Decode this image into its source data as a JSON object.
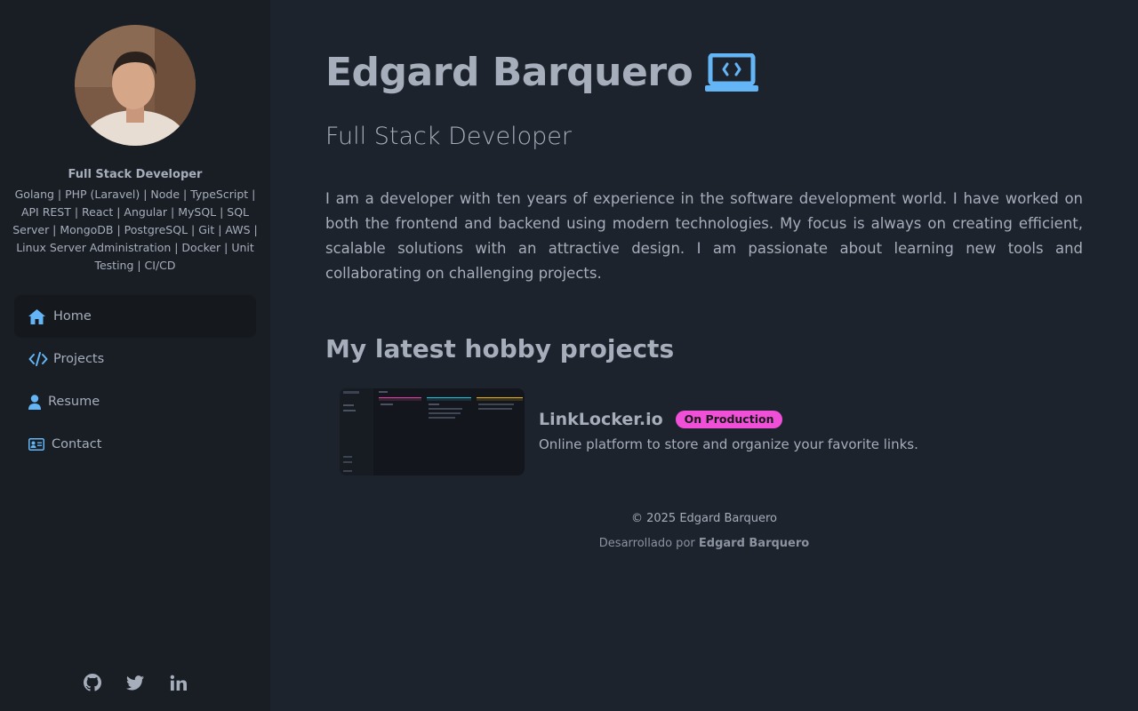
{
  "sidebar": {
    "title": "Full Stack Developer",
    "skills": "Golang | PHP (Laravel) | Node | TypeScript | API REST | React | Angular | MySQL | SQL Server | MongoDB | PostgreSQL | Git | AWS | Linux Server Administration | Docker | Unit Testing | CI/CD",
    "nav": [
      {
        "label": "Home",
        "icon": "home-icon",
        "active": true
      },
      {
        "label": "Projects",
        "icon": "code-icon",
        "active": false
      },
      {
        "label": "Resume",
        "icon": "user-icon",
        "active": false
      },
      {
        "label": "Contact",
        "icon": "contact-card-icon",
        "active": false
      }
    ],
    "social": [
      "github-icon",
      "twitter-icon",
      "linkedin-icon"
    ]
  },
  "main": {
    "name": "Edgard Barquero",
    "name_icon": "laptop-code-icon",
    "role": "Full Stack Developer",
    "bio": "I am a developer with ten years of experience in the software development world. I have worked on both the frontend and backend using modern technologies. My focus is always on creating efficient, scalable solutions with an attractive design. I am passionate about learning new tools and collaborating on challenging projects.",
    "projects_title": "My latest hobby projects",
    "projects": [
      {
        "name": "LinkLocker.io",
        "badge": "On Production",
        "description": "Online platform to store and organize your favorite links."
      }
    ]
  },
  "footer": {
    "copyright": "© 2025 Edgard Barquero",
    "developed_prefix": "Desarrollado por",
    "developed_name": "Edgard Barquero"
  },
  "colors": {
    "background": "#1d232c",
    "sidebar": "#191e24",
    "accent": "#64b5f6",
    "badge": "#f050d7",
    "text": "#a6adbb"
  }
}
